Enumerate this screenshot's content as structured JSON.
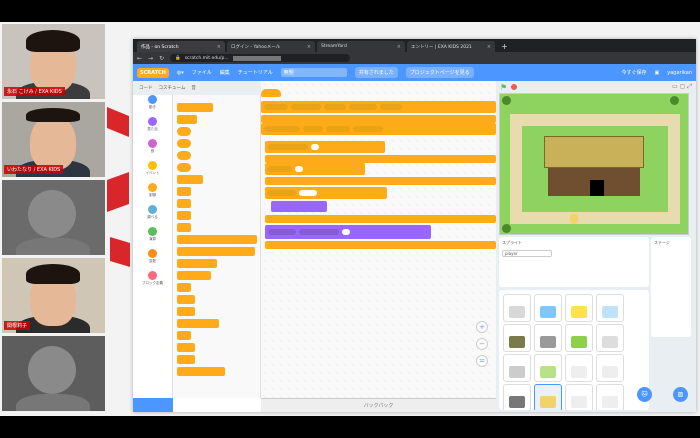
{
  "video": {
    "participants": [
      {
        "name": "永石 こけみ / EXA KIDS"
      },
      {
        "name": "いわたなり / EXA KIDS"
      },
      {
        "name": ""
      },
      {
        "name": "関根莉子"
      },
      {
        "name": ""
      }
    ]
  },
  "browser": {
    "tabs": [
      {
        "label": "作品 - on Scratch",
        "active": true
      },
      {
        "label": "ログイン - Yahooメール",
        "active": false
      },
      {
        "label": "StreamYard",
        "active": false
      },
      {
        "label": "エントリー | EXA KIDS 2021",
        "active": false
      }
    ],
    "url": "scratch.mit.edu/p..."
  },
  "scratch": {
    "menu": {
      "logo": "SCRATCH",
      "file": "ファイル",
      "edit": "編集",
      "tutorials": "チュートリアル",
      "project_title": "無題",
      "share": "共有されました",
      "project_page": "プロジェクトページを見る",
      "save_now": "今すぐ保存",
      "username": "yagarikan"
    },
    "tabs": {
      "code": "コード",
      "costumes": "コスチューム",
      "sounds": "音"
    },
    "categories": [
      {
        "label": "動き",
        "color": "#4c97ff"
      },
      {
        "label": "見た目",
        "color": "#9966ff"
      },
      {
        "label": "音",
        "color": "#cf63cf"
      },
      {
        "label": "イベント",
        "color": "#ffbf00"
      },
      {
        "label": "制御",
        "color": "#ffab19"
      },
      {
        "label": "調べる",
        "color": "#5cb1d6"
      },
      {
        "label": "演算",
        "color": "#59c059"
      },
      {
        "label": "変数",
        "color": "#ff8c1a"
      },
      {
        "label": "ブロック定義",
        "color": "#ff6680"
      }
    ],
    "backpack": "バックパック",
    "sprite_label": "スプライト",
    "sprite_name": "player",
    "stage_label": "ステージ"
  }
}
